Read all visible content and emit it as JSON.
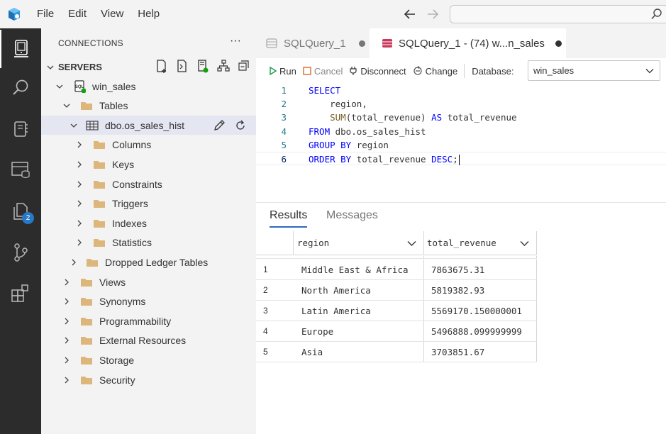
{
  "colors": {
    "activity_bar": "#2c2c2c",
    "sidebar": "#f3f3f3",
    "selected_row": "#e4e6f1",
    "folder": "#dcb67a",
    "keyword": "#0000ff",
    "function": "#795e26",
    "identifier": "#001080",
    "run_green": "#1a9b4b",
    "cancel_orange": "#d96b2a",
    "accent": "#2d68c4",
    "connected_dot": "#13a10e",
    "badge": "#2778c6"
  },
  "menu": [
    "File",
    "Edit",
    "View",
    "Help"
  ],
  "activity_bar": {
    "items": [
      "connections-icon",
      "search-icon",
      "notebooks-icon",
      "dashboards-icon",
      "explorer-icon",
      "source-control-icon",
      "extensions-icon"
    ],
    "explorer_badge": "2"
  },
  "sidebar": {
    "title": "CONNECTIONS",
    "more": "···",
    "servers_label": "SERVERS",
    "tree": [
      {
        "label": "win_sales",
        "level": 1,
        "icon": "server-icon",
        "expanded": true
      },
      {
        "label": "Tables",
        "level": 2,
        "icon": "folder-icon",
        "expanded": true
      },
      {
        "label": "dbo.os_sales_hist",
        "level": 3,
        "icon": "table-icon",
        "expanded": true,
        "selected": true
      },
      {
        "label": "Columns",
        "level": 4,
        "icon": "folder-icon",
        "expanded": false
      },
      {
        "label": "Keys",
        "level": 4,
        "icon": "folder-icon",
        "expanded": false
      },
      {
        "label": "Constraints",
        "level": 4,
        "icon": "folder-icon",
        "expanded": false
      },
      {
        "label": "Triggers",
        "level": 4,
        "icon": "folder-icon",
        "expanded": false
      },
      {
        "label": "Indexes",
        "level": 4,
        "icon": "folder-icon",
        "expanded": false
      },
      {
        "label": "Statistics",
        "level": 4,
        "icon": "folder-icon",
        "expanded": false
      },
      {
        "label": "Dropped Ledger Tables",
        "level": 3,
        "icon": "folder-icon",
        "expanded": false
      },
      {
        "label": "Views",
        "level": 2,
        "icon": "folder-icon",
        "expanded": false
      },
      {
        "label": "Synonyms",
        "level": 2,
        "icon": "folder-icon",
        "expanded": false
      },
      {
        "label": "Programmability",
        "level": 2,
        "icon": "folder-icon",
        "expanded": false
      },
      {
        "label": "External Resources",
        "level": 2,
        "icon": "folder-icon",
        "expanded": false
      },
      {
        "label": "Storage",
        "level": 2,
        "icon": "folder-icon",
        "expanded": false
      },
      {
        "label": "Security",
        "level": 2,
        "icon": "folder-icon",
        "expanded": false
      }
    ]
  },
  "tabs": [
    {
      "label": "SQLQuery_1",
      "active": false,
      "dirty": true
    },
    {
      "label": "SQLQuery_1 - (74) w...n_sales",
      "active": true,
      "dirty": true
    }
  ],
  "toolbar": {
    "run": "Run",
    "cancel": "Cancel",
    "disconnect": "Disconnect",
    "change": "Change",
    "database_label": "Database:",
    "database_value": "win_sales"
  },
  "editor": {
    "lines": [
      {
        "n": "1",
        "tokens": [
          {
            "t": "SELECT",
            "c": "kw"
          }
        ]
      },
      {
        "n": "2",
        "tokens": [
          {
            "t": "    region,",
            "c": "plain"
          }
        ]
      },
      {
        "n": "3",
        "tokens": [
          {
            "t": "    ",
            "c": "plain"
          },
          {
            "t": "SUM",
            "c": "fn"
          },
          {
            "t": "(total_revenue) ",
            "c": "plain"
          },
          {
            "t": "AS",
            "c": "kw"
          },
          {
            "t": " total_revenue",
            "c": "plain"
          }
        ]
      },
      {
        "n": "4",
        "tokens": [
          {
            "t": "FROM",
            "c": "kw"
          },
          {
            "t": " dbo.os_sales_hist",
            "c": "plain"
          }
        ]
      },
      {
        "n": "5",
        "tokens": [
          {
            "t": "GROUP BY",
            "c": "kw"
          },
          {
            "t": " region",
            "c": "plain"
          }
        ]
      },
      {
        "n": "6",
        "tokens": [
          {
            "t": "ORDER BY",
            "c": "kw"
          },
          {
            "t": " total_revenue ",
            "c": "plain"
          },
          {
            "t": "DESC",
            "c": "kw"
          },
          {
            "t": ";",
            "c": "plain"
          }
        ],
        "current": true
      }
    ]
  },
  "results": {
    "tabs": [
      "Results",
      "Messages"
    ],
    "columns": [
      "region",
      "total_revenue"
    ],
    "rows": [
      {
        "n": "1",
        "region": "Middle East & Africa",
        "total_revenue": "7863675.31"
      },
      {
        "n": "2",
        "region": "North America",
        "total_revenue": "5819382.93"
      },
      {
        "n": "3",
        "region": "Latin America",
        "total_revenue": "5569170.150000001"
      },
      {
        "n": "4",
        "region": "Europe",
        "total_revenue": "5496888.099999999"
      },
      {
        "n": "5",
        "region": "Asia",
        "total_revenue": "3703851.67"
      }
    ]
  }
}
